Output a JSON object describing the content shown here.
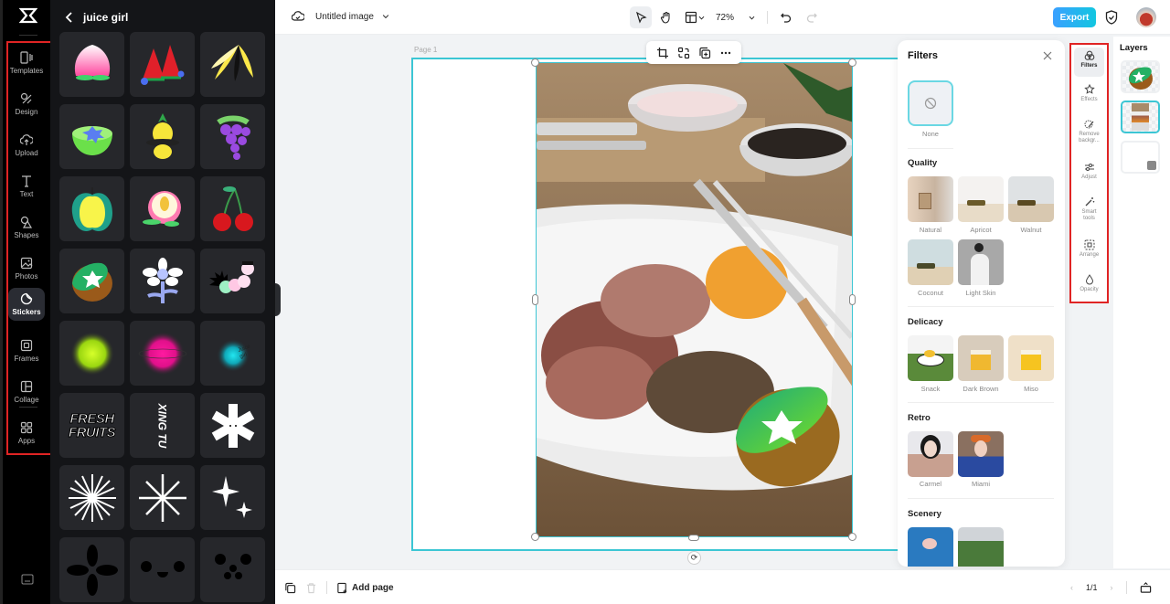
{
  "app": {
    "logo": "capcut-logo"
  },
  "rail": {
    "items": [
      {
        "label": "Templates",
        "icon": "templates-icon"
      },
      {
        "label": "Design",
        "icon": "design-icon"
      },
      {
        "label": "Upload",
        "icon": "upload-icon"
      },
      {
        "label": "Text",
        "icon": "text-icon"
      },
      {
        "label": "Shapes",
        "icon": "shapes-icon"
      },
      {
        "label": "Photos",
        "icon": "photos-icon"
      },
      {
        "label": "Stickers",
        "icon": "stickers-icon",
        "active": true
      },
      {
        "label": "Frames",
        "icon": "frames-icon"
      },
      {
        "label": "Collage",
        "icon": "collage-icon"
      },
      {
        "label": "Apps",
        "icon": "apps-icon"
      }
    ]
  },
  "stickers": {
    "title": "juice girl",
    "items": [
      "peach",
      "watermelon",
      "bananas",
      "kiwi-bowl",
      "pineapple-ufo",
      "grapes",
      "apple",
      "peach-half",
      "cherries",
      "kiwi-half",
      "flower",
      "caterpillar",
      "green-glow",
      "pink-glow",
      "juice-girl-glow",
      "fresh-fruits-text",
      "xing-tu-text",
      "asterisk-face",
      "starburst",
      "asterisk",
      "sparkles",
      "four-petal",
      "face-dots",
      "bear-face"
    ],
    "text_fresh": "FRESH",
    "text_fruits": "FRUITS",
    "text_xingtu": "XING TU"
  },
  "topbar": {
    "title": "Untitled image",
    "zoom": "72%",
    "export_label": "Export"
  },
  "canvas": {
    "page_label": "Page 1"
  },
  "filters": {
    "title": "Filters",
    "none_label": "None",
    "sections": [
      {
        "title": "Quality",
        "items": [
          "Natural",
          "Apricot",
          "Walnut",
          "Coconut",
          "Light Skin"
        ]
      },
      {
        "title": "Delicacy",
        "items": [
          "Snack",
          "Dark Brown",
          "Miso"
        ]
      },
      {
        "title": "Retro",
        "items": [
          "Carmel",
          "Miami"
        ]
      },
      {
        "title": "Scenery",
        "items": [
          "",
          ""
        ]
      }
    ]
  },
  "props": {
    "items": [
      {
        "label": "Filters",
        "active": true
      },
      {
        "label": "Effects"
      },
      {
        "label": "Remove backgr..."
      },
      {
        "label": "Adjust"
      },
      {
        "label": "Smart tools"
      },
      {
        "label": "Arrange"
      },
      {
        "label": "Opacity"
      }
    ]
  },
  "layers": {
    "title": "Layers"
  },
  "bottombar": {
    "add_page": "Add page",
    "page_indicator": "1/1"
  }
}
